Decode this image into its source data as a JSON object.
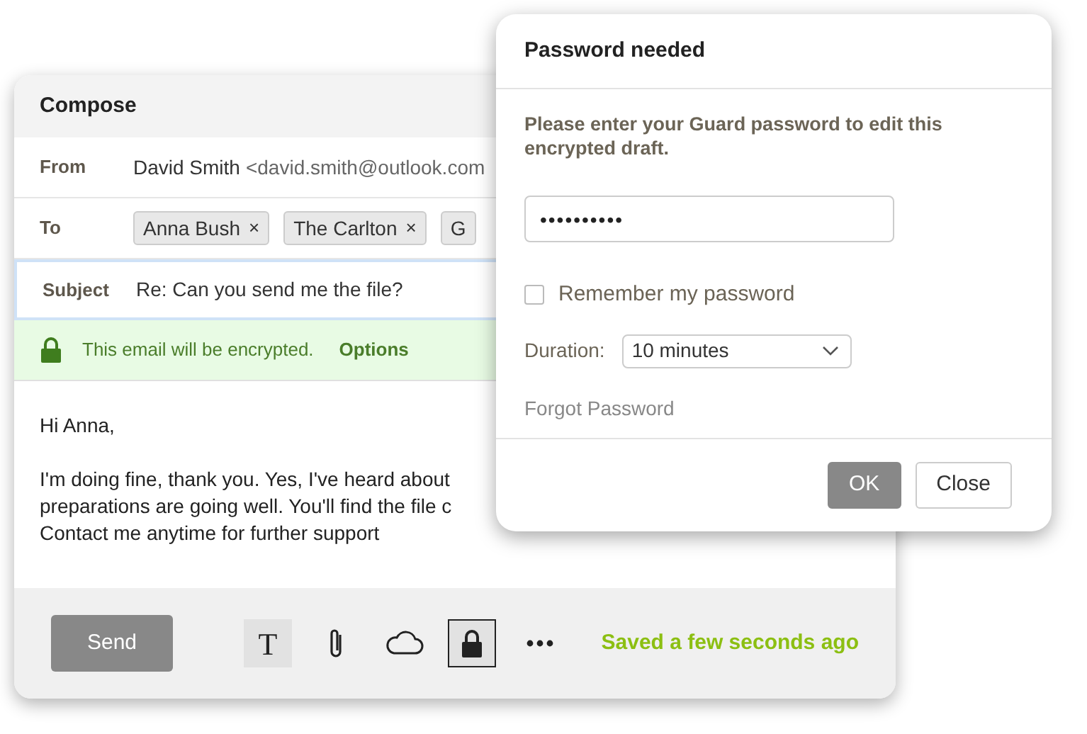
{
  "compose": {
    "title": "Compose",
    "from": {
      "label": "From",
      "name": "David Smith",
      "address": "<david.smith@outlook.com"
    },
    "to": {
      "label": "To",
      "recipients": [
        {
          "name": "Anna Bush",
          "remove": "×"
        },
        {
          "name": "The Carlton",
          "remove": "×"
        },
        {
          "name": "G"
        }
      ]
    },
    "subject": {
      "label": "Subject",
      "value": "Re: Can you send me the file?",
      "focused": true
    },
    "encryption": {
      "message": "This email will be encrypted.",
      "link": "Options"
    },
    "body": {
      "greeting": "Hi Anna,",
      "lines": [
        "I'm doing fine, thank you. Yes, I've heard about",
        "preparations are going well. You'll find the file c",
        "Contact me anytime for further support"
      ]
    },
    "send": "Send",
    "tools": [
      {
        "kind": "text",
        "label": "T",
        "selected": false,
        "shaded": true
      },
      {
        "kind": "attach",
        "selected": false,
        "shaded": false
      },
      {
        "kind": "cloud",
        "selected": false,
        "shaded": false
      },
      {
        "kind": "lock",
        "selected": true,
        "shaded": true
      },
      {
        "kind": "more",
        "selected": false,
        "shaded": false
      }
    ],
    "status": "Saved a few seconds ago"
  },
  "dialog": {
    "title": "Password needed",
    "message": "Please enter your Guard password to edit this encrypted draft.",
    "password": "••••••••••",
    "remember": {
      "label": "Remember my password",
      "checked": false
    },
    "duration": {
      "label": "Duration:",
      "value": "10 minutes"
    },
    "forgot": "Forgot Password",
    "buttons": [
      {
        "label": "OK",
        "kind": "primary"
      },
      {
        "label": "Close",
        "kind": "secondary"
      }
    ]
  }
}
